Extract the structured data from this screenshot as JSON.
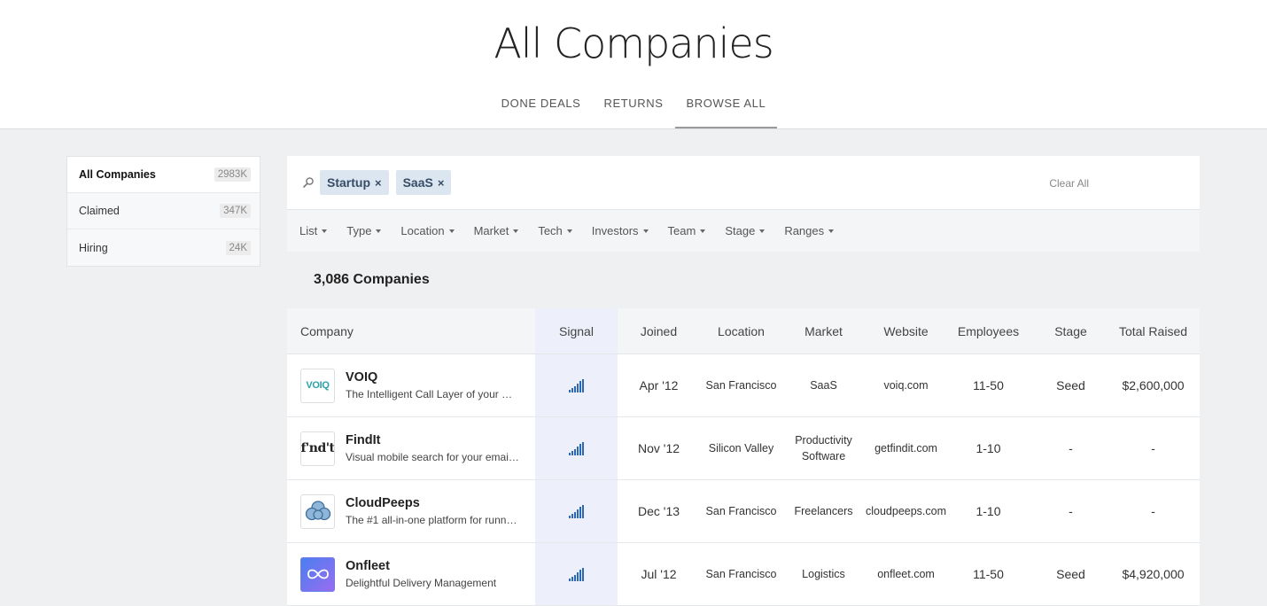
{
  "header": {
    "title": "All Companies",
    "tabs": [
      {
        "label": "DONE DEALS"
      },
      {
        "label": "RETURNS"
      },
      {
        "label": "BROWSE ALL"
      }
    ]
  },
  "sidebar": {
    "items": [
      {
        "label": "All Companies",
        "count": "2983K"
      },
      {
        "label": "Claimed",
        "count": "347K"
      },
      {
        "label": "Hiring",
        "count": "24K"
      }
    ]
  },
  "search": {
    "chips": [
      {
        "label": "Startup",
        "remove": "×"
      },
      {
        "label": "SaaS",
        "remove": "×"
      }
    ],
    "clear_label": "Clear All"
  },
  "filters": [
    "List",
    "Type",
    "Location",
    "Market",
    "Tech",
    "Investors",
    "Team",
    "Stage",
    "Ranges"
  ],
  "results": {
    "count_label": "3,086 Companies"
  },
  "table": {
    "columns": {
      "company": "Company",
      "signal": "Signal",
      "joined": "Joined",
      "location": "Location",
      "market": "Market",
      "website": "Website",
      "employees": "Employees",
      "stage": "Stage",
      "raised": "Total Raised"
    },
    "rows": [
      {
        "name": "VOIQ",
        "logo_text": "VOIQ",
        "desc": "The Intelligent Call Layer of your Sal...",
        "joined": "Apr '12",
        "location": "San Francisco",
        "market": "SaaS",
        "website": "voiq.com",
        "employees": "11-50",
        "stage": "Seed",
        "raised": "$2,600,000"
      },
      {
        "name": "FindIt",
        "logo_text": "f'nd't",
        "desc": "Visual mobile search for your email ...",
        "joined": "Nov '12",
        "location": "Silicon Valley",
        "market": "Productivity Software",
        "website": "getfindit.com",
        "employees": "1-10",
        "stage": "-",
        "raised": "-"
      },
      {
        "name": "CloudPeeps",
        "logo_text": "",
        "desc": "The #1 all-in-one platform for runnin...",
        "joined": "Dec '13",
        "location": "San Francisco",
        "market": "Freelancers",
        "website": "cloudpeeps.com",
        "employees": "1-10",
        "stage": "-",
        "raised": "-"
      },
      {
        "name": "Onfleet",
        "logo_text": "",
        "desc": "Delightful Delivery Management",
        "joined": "Jul '12",
        "location": "San Francisco",
        "market": "Logistics",
        "website": "onfleet.com",
        "employees": "11-50",
        "stage": "Seed",
        "raised": "$4,920,000"
      }
    ]
  },
  "colors": {
    "accent": "#2a67b5",
    "chip_bg": "#dbe6f0",
    "signal_col_bg": "#edf0fb",
    "page_bg": "#eff0f2"
  },
  "icons": {
    "search": "magnifier-icon",
    "signal": "signal-bars-icon",
    "caret": "caret-down-icon"
  }
}
